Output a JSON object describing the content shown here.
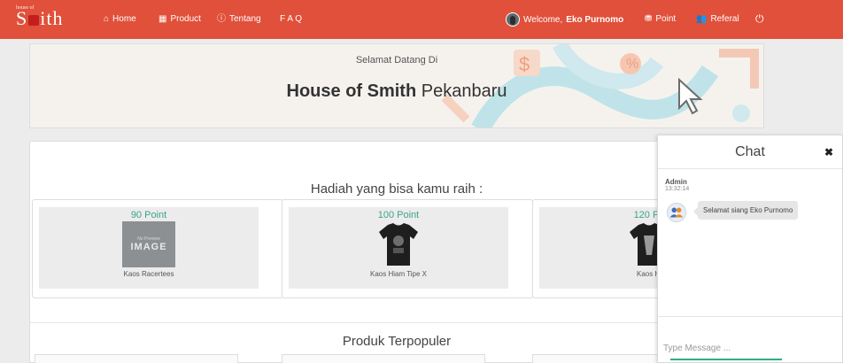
{
  "navbar": {
    "brand_small": "house of",
    "brand_main_pre": "S",
    "brand_main_post": "ith",
    "items": [
      {
        "icon": "home-icon",
        "glyph": "⌂",
        "label": "Home"
      },
      {
        "icon": "grid-icon",
        "glyph": "▦",
        "label": "Product"
      },
      {
        "icon": "info-icon",
        "glyph": "ⓘ",
        "label": "Tentang"
      },
      {
        "label": "F A Q"
      }
    ],
    "welcome_prefix": "Welcome,",
    "welcome_name": "Eko Purnomo",
    "point_label": "Point",
    "point_glyph": "⛃",
    "referal_label": "Referal",
    "referal_glyph": "👥",
    "power_glyph": "⏻",
    "color": "#e0503a"
  },
  "banner": {
    "subtitle": "Selamat Datang Di",
    "title_bold": "House of Smith",
    "title_rest": " Pekanbaru"
  },
  "rewards": {
    "heading": "Hadiah yang bisa kamu raih :",
    "cards": [
      {
        "points": "90 Point",
        "name": "Kaos Racertees",
        "image": "no-preview",
        "noimg_small": "No Preview",
        "noimg_big": "IMAGE"
      },
      {
        "points": "100 Point",
        "name": "Kaos Hiam Tipe X",
        "image": "black-tshirt"
      },
      {
        "points": "120 Po",
        "name": "Kaos Hi",
        "image": "black-tshirt"
      }
    ]
  },
  "popular": {
    "heading": "Produk Terpopuler"
  },
  "chat": {
    "title": "Chat",
    "close_glyph": "✖",
    "message": {
      "sender": "Admin",
      "time": "13:32:14",
      "text": "Selamat siang Eko Purnomo"
    },
    "input_placeholder": "Type Message ...",
    "accent": "#2bb07e"
  }
}
